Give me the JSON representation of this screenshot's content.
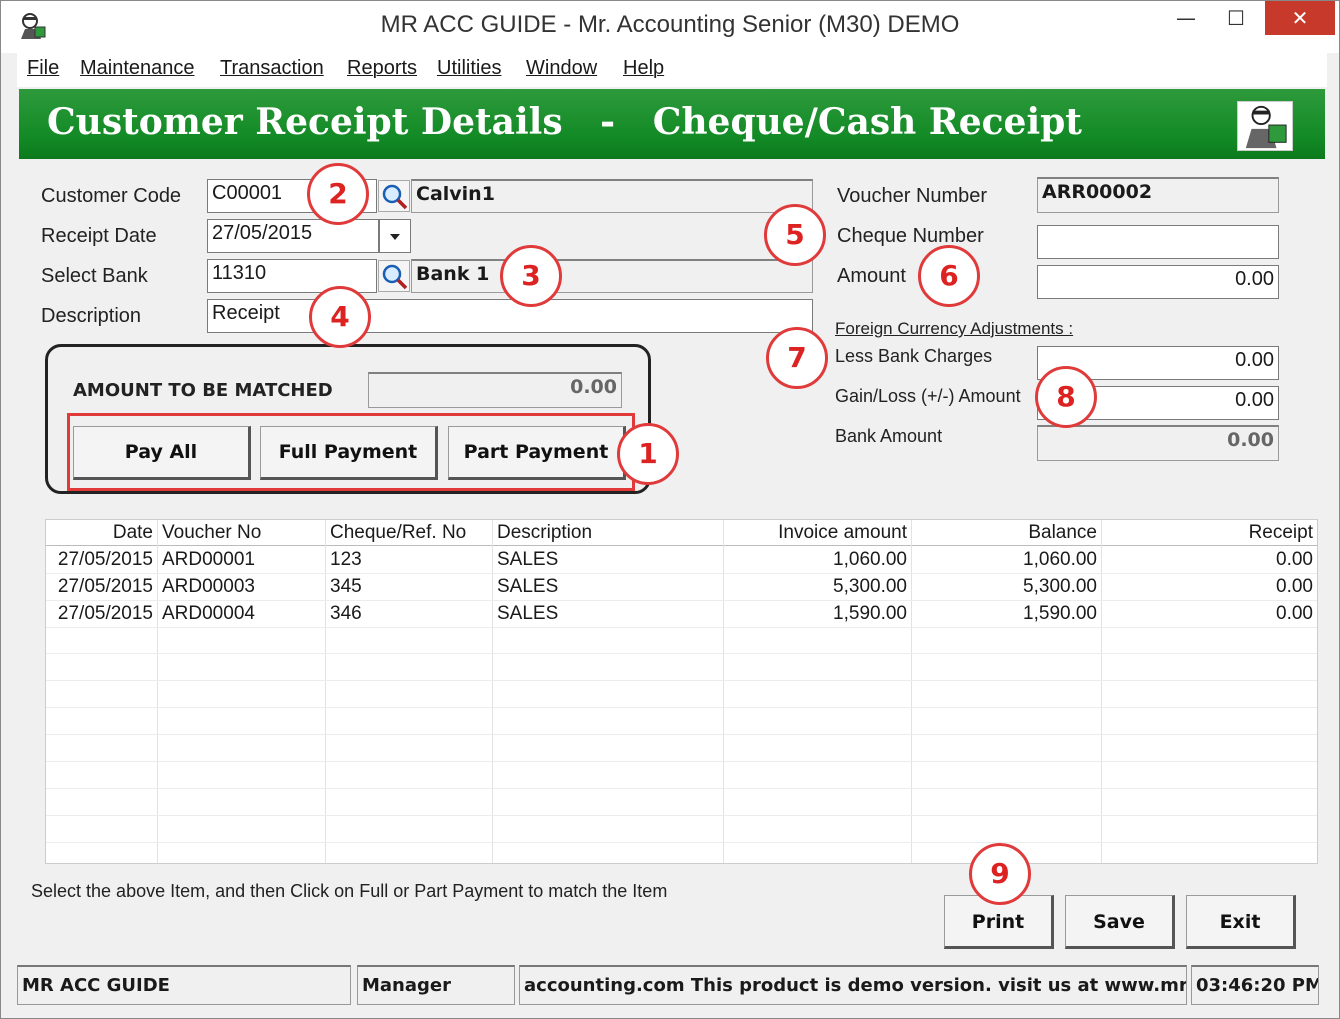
{
  "window": {
    "title": "MR ACC GUIDE - Mr. Accounting Senior (M30) DEMO",
    "min_label": "—",
    "max_label": "☐",
    "close_label": "✕"
  },
  "menu": [
    "File",
    "Maintenance",
    "Transaction",
    "Reports",
    "Utilities",
    "Window",
    "Help"
  ],
  "banner": {
    "title": "Customer Receipt Details   -   Cheque/Cash Receipt"
  },
  "form": {
    "customer_code_label": "Customer Code",
    "customer_code": "C00001",
    "customer_name": "Calvin1",
    "receipt_date_label": "Receipt Date",
    "receipt_date": "27/05/2015",
    "select_bank_label": "Select Bank",
    "bank_code": "11310",
    "bank_name": "Bank 1",
    "description_label": "Description",
    "description": "Receipt",
    "voucher_number_label": "Voucher Number",
    "voucher_number": "ARR00002",
    "cheque_number_label": "Cheque Number",
    "cheque_number": "",
    "amount_label": "Amount",
    "amount": "0.00",
    "fx_heading": "Foreign Currency Adjustments :",
    "bank_charges_label": "Less Bank Charges",
    "bank_charges": "0.00",
    "gain_loss_label": "Gain/Loss (+/-) Amount",
    "gain_loss": "0.00",
    "bank_amount_label": "Bank Amount",
    "bank_amount": "0.00"
  },
  "match": {
    "label": "AMOUNT TO BE MATCHED",
    "value": "0.00",
    "pay_all": "Pay All",
    "full_payment": "Full Payment",
    "part_payment": "Part Payment"
  },
  "table": {
    "headers": [
      "Date",
      "Voucher No",
      "Cheque/Ref. No",
      "Description",
      "Invoice amount",
      "Balance",
      "Receipt"
    ],
    "rows": [
      [
        "27/05/2015",
        "ARD00001",
        "123",
        "SALES",
        "1,060.00",
        "1,060.00",
        "0.00"
      ],
      [
        "27/05/2015",
        "ARD00003",
        "345",
        "SALES",
        "5,300.00",
        "5,300.00",
        "0.00"
      ],
      [
        "27/05/2015",
        "ARD00004",
        "346",
        "SALES",
        "1,590.00",
        "1,590.00",
        "0.00"
      ]
    ]
  },
  "hint": "Select the above Item, and then Click on Full or Part Payment to match the Item",
  "buttons": {
    "print": "Print",
    "save": "Save",
    "exit": "Exit"
  },
  "status": {
    "app": "MR ACC GUIDE",
    "user": "Manager",
    "message": "accounting.com This product is demo version.  visit us at www.mr-",
    "time": "03:46:20 PM"
  },
  "badges": [
    "1",
    "2",
    "3",
    "4",
    "5",
    "6",
    "7",
    "8",
    "9"
  ],
  "colors": {
    "banner": "#128a25",
    "badge": "#e03a3a",
    "close": "#c7392b"
  }
}
